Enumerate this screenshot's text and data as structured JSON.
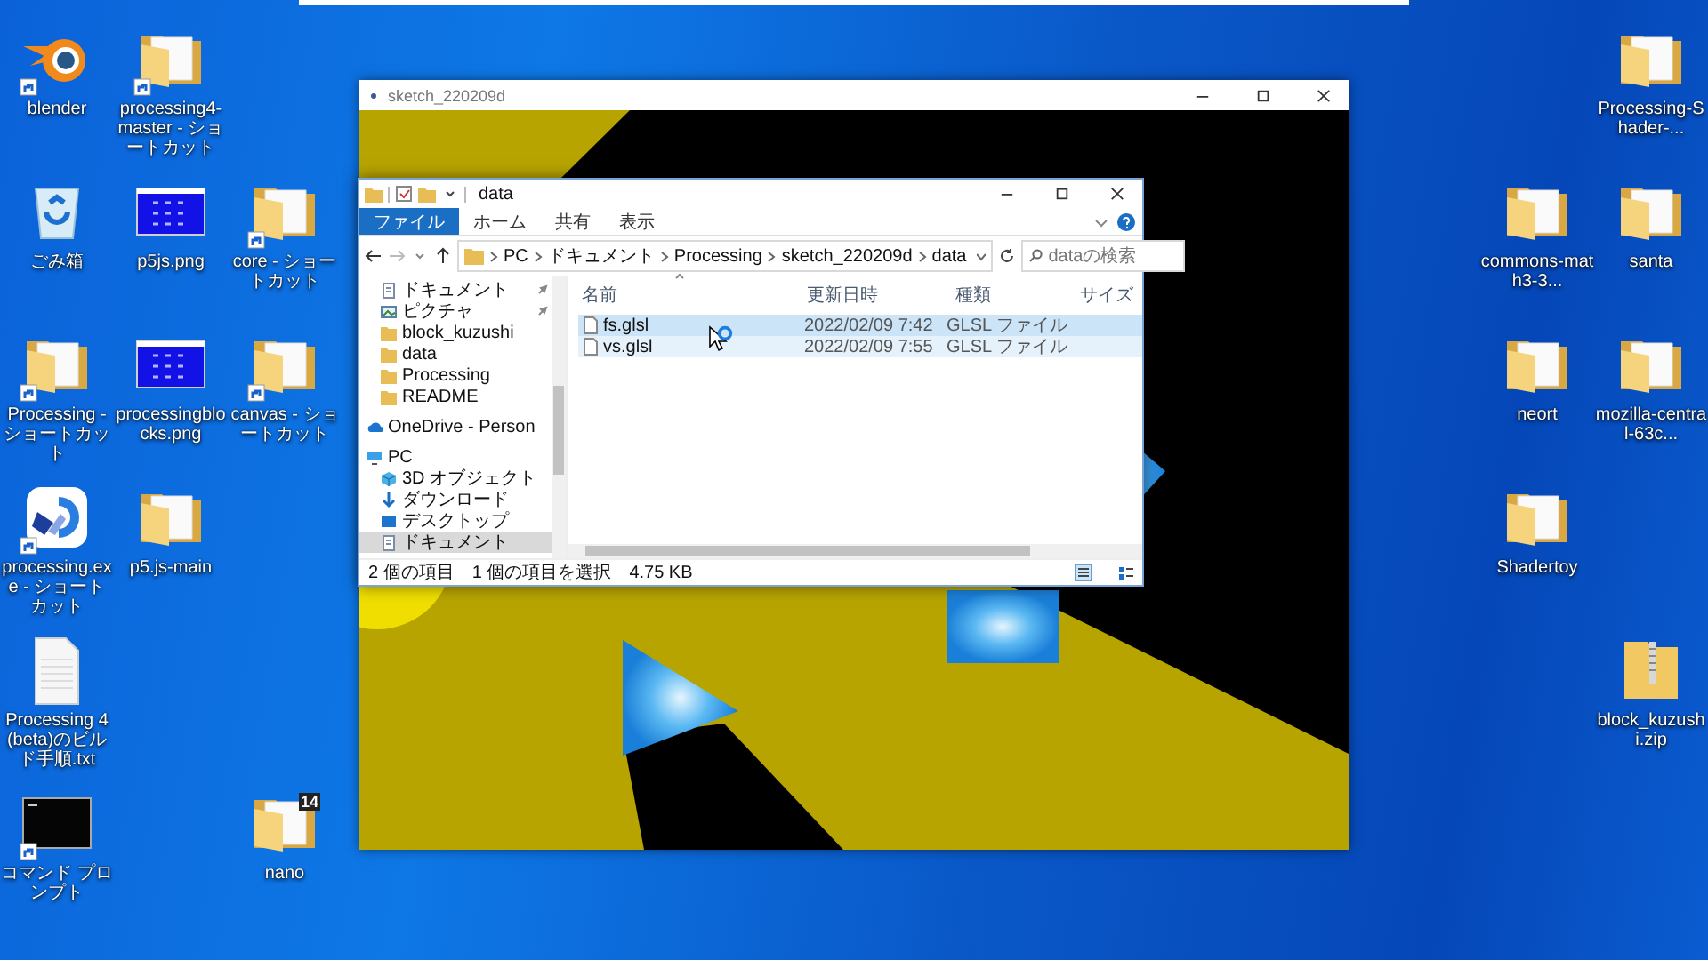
{
  "desktop": {
    "left_columns": [
      {
        "slots": [
          {
            "kind": "blender",
            "label": "blender",
            "shortcut": true
          },
          {
            "kind": "recycle-bin",
            "label": "ごみ箱",
            "shortcut": false
          },
          {
            "kind": "folder",
            "label": "Processing - ショートカット",
            "shortcut": true
          },
          {
            "kind": "processing-app",
            "label": "processing.exe - ショートカット",
            "shortcut": true
          },
          {
            "kind": "text-file",
            "label": "Processing 4 (beta)のビルド手順.txt",
            "shortcut": false
          },
          {
            "kind": "console",
            "label": "コマンド プロンプト",
            "shortcut": true
          }
        ]
      },
      {
        "slots": [
          {
            "kind": "folder",
            "label": "processing4-master - ショートカット",
            "shortcut": true
          },
          {
            "kind": "image",
            "label": "p5js.png",
            "shortcut": false
          },
          {
            "kind": "image",
            "label": "processingblocks.png",
            "shortcut": false
          },
          {
            "kind": "folder",
            "label": "p5.js-main",
            "shortcut": false
          }
        ]
      },
      {
        "slots": [
          {
            "kind": "empty"
          },
          {
            "kind": "folder",
            "label": "core - ショートカット",
            "shortcut": true
          },
          {
            "kind": "folder",
            "label": "canvas - ショートカット",
            "shortcut": true
          },
          {
            "kind": "empty"
          },
          {
            "kind": "empty"
          },
          {
            "kind": "folder",
            "label": "nano",
            "shortcut": false,
            "badge": "14"
          }
        ]
      }
    ],
    "right_columns": [
      {
        "slots": [
          {
            "kind": "empty"
          },
          {
            "kind": "folder",
            "label": "commons-math3-3...",
            "shortcut": false
          },
          {
            "kind": "folder",
            "label": "neort",
            "shortcut": false
          },
          {
            "kind": "folder",
            "label": "Shadertoy",
            "shortcut": false
          }
        ]
      },
      {
        "slots": [
          {
            "kind": "folder",
            "label": "Processing-Shader-...",
            "shortcut": false
          },
          {
            "kind": "folder",
            "label": "santa",
            "shortcut": false
          },
          {
            "kind": "folder",
            "label": "mozilla-central-63c...",
            "shortcut": false
          },
          {
            "kind": "empty"
          },
          {
            "kind": "zip",
            "label": "block_kuzushi.zip",
            "shortcut": false
          }
        ]
      }
    ]
  },
  "sketch_window": {
    "title": "sketch_220209d"
  },
  "explorer": {
    "title": "data",
    "ribbon_tabs": [
      {
        "label": "ファイル",
        "selected": true
      },
      {
        "label": "ホーム",
        "selected": false
      },
      {
        "label": "共有",
        "selected": false
      },
      {
        "label": "表示",
        "selected": false
      }
    ],
    "breadcrumb": [
      "PC",
      "ドキュメント",
      "Processing",
      "sketch_220209d",
      "data"
    ],
    "search": {
      "placeholder": "dataの検索"
    },
    "quick_access": [
      {
        "kind": "documents",
        "label": "ドキュメント",
        "pinned": true
      },
      {
        "kind": "pictures",
        "label": "ピクチャ",
        "pinned": true
      },
      {
        "kind": "folder",
        "label": "block_kuzushi",
        "pinned": false
      },
      {
        "kind": "folder",
        "label": "data",
        "pinned": false
      },
      {
        "kind": "folder",
        "label": "Processing",
        "pinned": false
      },
      {
        "kind": "folder",
        "label": "README",
        "pinned": false
      }
    ],
    "nav_items": [
      {
        "kind": "cloud",
        "label": "OneDrive - Person",
        "selected": false
      },
      {
        "kind": "pc",
        "label": "PC",
        "selected": false,
        "children": [
          {
            "kind": "cube",
            "label": "3D オブジェクト",
            "selected": false
          },
          {
            "kind": "download",
            "label": "ダウンロード",
            "selected": false
          },
          {
            "kind": "desktop",
            "label": "デスクトップ",
            "selected": false
          },
          {
            "kind": "documents",
            "label": "ドキュメント",
            "selected": true
          }
        ]
      }
    ],
    "columns": [
      "名前",
      "更新日時",
      "種類",
      "サイズ"
    ],
    "files": [
      {
        "name": "fs.glsl",
        "modified": "2022/02/09 7:42",
        "type": "GLSL ファイル",
        "selected": true,
        "hovered": false
      },
      {
        "name": "vs.glsl",
        "modified": "2022/02/09 7:55",
        "type": "GLSL ファイル",
        "selected": false,
        "hovered": true
      }
    ],
    "status": {
      "count": "2 個の項目",
      "selection": "1 個の項目を選択",
      "size": "4.75 KB"
    }
  }
}
